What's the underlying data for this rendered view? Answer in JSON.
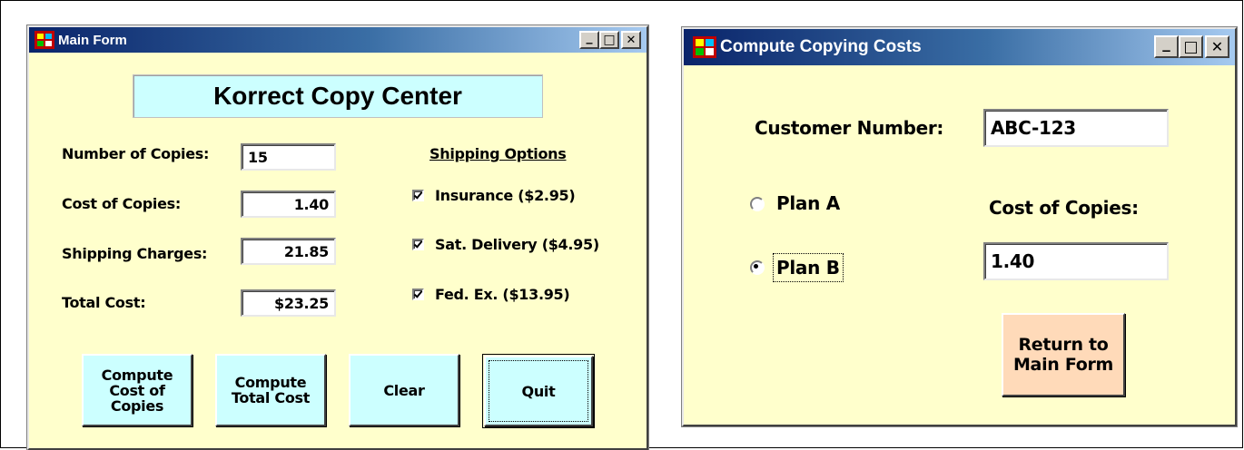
{
  "main_form": {
    "title": "Main Form",
    "heading": "Korrect Copy Center",
    "fields": {
      "copies_label": "Number of Copies:",
      "copies_value": "15",
      "cost_label": "Cost of Copies:",
      "cost_value": "1.40",
      "shipping_label": "Shipping Charges:",
      "shipping_value": "21.85",
      "total_label": "Total Cost:",
      "total_value": "$23.25"
    },
    "shipping_options": {
      "header": "Shipping Options",
      "insurance": "Insurance ($2.95)",
      "saturday": "Sat. Delivery ($4.95)",
      "fedex": "Fed. Ex. ($13.95)"
    },
    "buttons": {
      "compute_cost": "Compute\nCost of\nCopies",
      "compute_total": "Compute\nTotal Cost",
      "clear": "Clear",
      "quit": "Quit"
    },
    "caption": {
      "minimize": "_",
      "maximize": "□",
      "close": "✕"
    }
  },
  "copy_form": {
    "title": "Compute Copying Costs",
    "customer_label": "Customer Number:",
    "customer_value": "ABC-123",
    "plan_a": "Plan A",
    "plan_b": "Plan B",
    "plan_b_selected": true,
    "cost_label": "Cost of Copies:",
    "cost_value": "1.40",
    "return_button": "Return to\nMain Form",
    "caption": {
      "minimize": "_",
      "maximize": "□",
      "close": "✕"
    }
  },
  "colors": {
    "form_background": "#ffffcc",
    "title_gradient_start": "#0a246a",
    "title_gradient_end": "#a6caf0",
    "button_cyan": "#ccffff",
    "button_peach": "#ffdab9"
  },
  "icons": [
    "window-app-icon",
    "checkbox-checked-icon",
    "radio-selected-icon"
  ]
}
